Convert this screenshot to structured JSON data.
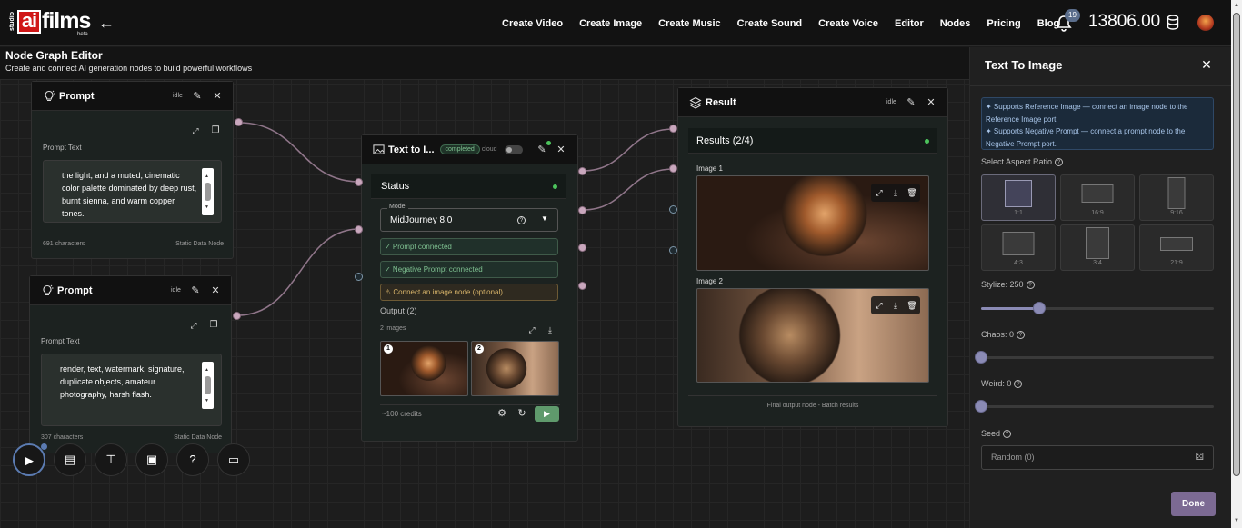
{
  "brand": {
    "studio": "studio",
    "ai": "ai",
    "films": "films",
    "beta": "beta"
  },
  "nav": [
    "Create Video",
    "Create Image",
    "Create Music",
    "Create Sound",
    "Create Voice",
    "Editor",
    "Nodes",
    "Pricing",
    "Blog"
  ],
  "notifications": {
    "count": "19"
  },
  "credits": "13806.00",
  "editor": {
    "title": "Node Graph Editor",
    "subtitle": "Create and connect AI generation nodes to build powerful workflows"
  },
  "prompt1": {
    "title": "Prompt",
    "state": "idle",
    "field_label": "Prompt Text",
    "text": "the light, and a muted, cinematic color palette dominated by deep rust, burnt sienna, and warm copper tones.",
    "chars": "691 characters",
    "kind": "Static Data Node"
  },
  "prompt2": {
    "title": "Prompt",
    "state": "idle",
    "field_label": "Prompt Text",
    "text": "render, text, watermark, signature, duplicate objects, amateur photography, harsh flash.",
    "chars": "307 characters",
    "kind": "Static Data Node"
  },
  "t2i": {
    "title": "Text to I...",
    "badge": "completed",
    "cloud": "cloud",
    "status": "Status",
    "model_label": "Model",
    "model": "MidJourney 8.0",
    "chips": [
      "✓ Prompt connected",
      "✓ Negative Prompt connected",
      "⚠ Connect an image node (optional)"
    ],
    "output_label": "Output (2)",
    "images_count": "2 images",
    "thumb_nums": [
      "1",
      "2"
    ],
    "cost": "~100 credits"
  },
  "result": {
    "title": "Result",
    "state": "idle",
    "results_label": "Results (2/4)",
    "image1": "Image 1",
    "image2": "Image 2",
    "footer": "Final output node - Batch results"
  },
  "panel": {
    "title": "Text To Image",
    "info1": "✦ Supports Reference Image — connect an image node to the Reference Image port.",
    "info2": "✦ Supports Negative Prompt — connect a prompt node to the Negative Prompt port.",
    "aspect_label": "Select Aspect Ratio",
    "ratios": [
      "1:1",
      "16:9",
      "9:16",
      "4:3",
      "3:4",
      "21:9"
    ],
    "selected_ratio": "1:1",
    "stylize_label": "Stylize: 250",
    "stylize_value": 250,
    "stylize_max": 1000,
    "chaos_label": "Chaos: 0",
    "chaos_value": 0,
    "weird_label": "Weird: 0",
    "weird_value": 0,
    "seed_label": "Seed",
    "seed_placeholder": "Random (0)",
    "done": "Done"
  },
  "colors": {
    "accent": "#7c6a93",
    "success": "#5f9a6c",
    "brand_red": "#d01818"
  }
}
